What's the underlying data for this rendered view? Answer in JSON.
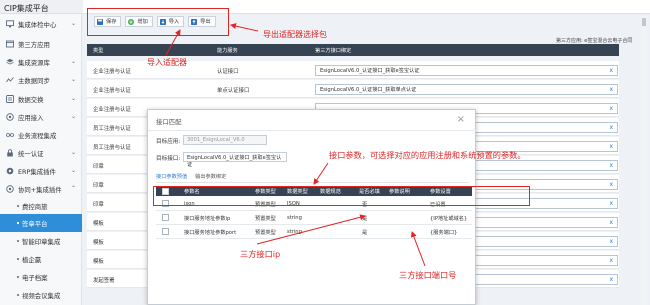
{
  "app": {
    "title": "CIP集成平台"
  },
  "sidebar": {
    "items": [
      {
        "label": "集成体检中心",
        "icon": "monitor-icon",
        "expandable": true
      },
      {
        "label": "第三方应用",
        "icon": "window-icon",
        "expandable": false
      },
      {
        "label": "集成资源库",
        "icon": "stack-icon",
        "expandable": true
      },
      {
        "label": "主数据同步",
        "icon": "sync-icon",
        "expandable": true
      },
      {
        "label": "数据交换",
        "icon": "exchange-icon",
        "expandable": true
      },
      {
        "label": "应用接入",
        "icon": "plug-icon",
        "expandable": true
      },
      {
        "label": "业务流程集成",
        "icon": "flow-icon",
        "expandable": false
      },
      {
        "label": "统一认证",
        "icon": "lock-icon",
        "expandable": true
      },
      {
        "label": "ERP集成插件",
        "icon": "puzzle-icon",
        "expandable": true
      },
      {
        "label": "协同+集成插件",
        "icon": "puzzle-icon",
        "expandable": true
      }
    ],
    "subitems": [
      {
        "label": "费控商旅",
        "active": false
      },
      {
        "label": "签章平台",
        "active": true
      },
      {
        "label": "智能印章集成",
        "active": false
      },
      {
        "label": "植企赢",
        "active": false
      },
      {
        "label": "电子档案",
        "active": false
      },
      {
        "label": "视频会议集成",
        "active": false
      }
    ]
  },
  "toolbar": {
    "buttons": [
      {
        "label": "保存",
        "icon": "save-icon",
        "color": "#2f6fbf"
      },
      {
        "label": "增加",
        "icon": "add-icon",
        "color": "#3fae4a"
      },
      {
        "label": "导入",
        "icon": "import-icon",
        "color": "#2f6fbf"
      },
      {
        "label": "导出",
        "icon": "export-icon",
        "color": "#2f6fbf"
      }
    ]
  },
  "main": {
    "right_note": "第三方应用: e签宝混合云电子合同",
    "table": {
      "headers": [
        "类型",
        "能力服务",
        "第三方接口绑定"
      ],
      "rows": [
        {
          "type": "企业注册与认证",
          "service": "认证接口",
          "binding": "EsignLocalV6.0_认证接口_获取e签宝认证"
        },
        {
          "type": "企业注册与认证",
          "service": "单点认证接口",
          "binding": "EsignLocalV6.0_认证接口_获取单点认证"
        },
        {
          "type": "企业注册与认证",
          "service": "",
          "binding": ""
        },
        {
          "type": "员工注册与认证",
          "service": "",
          "binding": ""
        },
        {
          "type": "员工注册与认证",
          "service": "",
          "binding": ""
        },
        {
          "type": "印章",
          "service": "",
          "binding": ""
        },
        {
          "type": "印章",
          "service": "",
          "binding": ""
        },
        {
          "type": "印章",
          "service": "",
          "binding": ""
        },
        {
          "type": "模板",
          "service": "",
          "binding": ""
        },
        {
          "type": "模板",
          "service": "",
          "binding": ""
        },
        {
          "type": "模板",
          "service": "",
          "binding": ""
        },
        {
          "type": "发起签署",
          "service": "",
          "binding": ""
        }
      ]
    }
  },
  "modal": {
    "title": "接口匹配",
    "close": "×",
    "target_app_label": "目标应用:",
    "target_app_value": "3001_EsignLocal_V6.0",
    "target_api_label": "目标接口:",
    "target_api_value": "EsignLocalV6.0_认证接口_获取e签宝认证",
    "tabs": [
      {
        "label": "接口参数预值",
        "active": true
      },
      {
        "label": "输出参数绑定",
        "active": false
      }
    ],
    "headers": [
      "参数名",
      "参数类型",
      "数据类型",
      "数据规范",
      "是否必填",
      "参数说明",
      "参数设置"
    ],
    "rows": [
      {
        "name": "json",
        "ptype": "预置类型",
        "dtype": "JSON",
        "spec": "",
        "required": "否",
        "desc": "",
        "setting": "已设置"
      },
      {
        "name": "接口服务地址参数ip",
        "ptype": "预置类型",
        "dtype": "string",
        "spec": "",
        "required": "是",
        "desc": "",
        "setting": "{IP地址或域名}"
      },
      {
        "name": "接口服务地址参数port",
        "ptype": "预置类型",
        "dtype": "string",
        "spec": "",
        "required": "是",
        "desc": "",
        "setting": "{服务端口}"
      }
    ]
  },
  "annotations": {
    "select_package": "导出适配器选择包",
    "import_adapter": "导入适配器",
    "params_note": "接口参数，可选择对应的应用注册和系统预置的参数。",
    "third_ip": "三方接口ip",
    "third_port": "三方接口端口号",
    "color": "#e02525"
  }
}
